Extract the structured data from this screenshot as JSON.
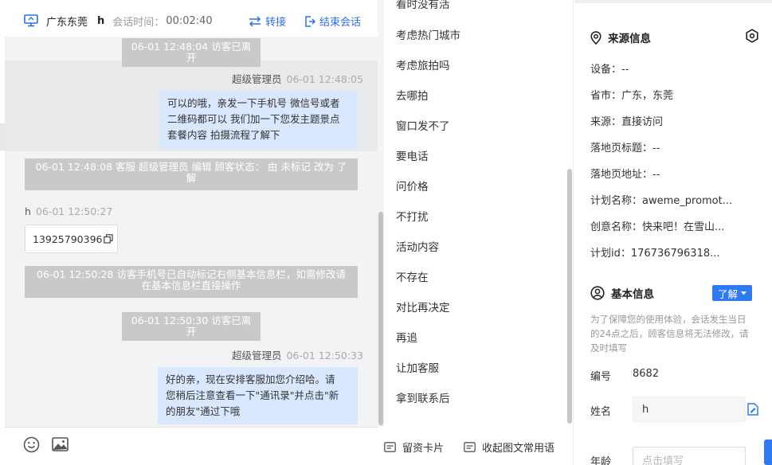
{
  "header": {
    "region": "广东东莞",
    "visitor_name": "h",
    "time_label": "会话时间：",
    "time_value": "00:02:40",
    "transfer_label": "转接",
    "end_label": "结束会话"
  },
  "messages": {
    "sys1": "06-01 12:48:04 访客已离开",
    "agent1_name": "超级管理员",
    "agent1_time": "06-01 12:48:05",
    "agent1_lines": [
      "可以的哦，亲发一下手机号 微信号或者",
      "二维码都可以 我们加一下您发主题景点",
      "套餐内容 拍摄流程了解下"
    ],
    "sys2_lines": [
      "06-01 12:48:08 客服 超级管理员 编辑 顾客状态： 由 未标记 改为 了",
      "解"
    ],
    "visitor_name": "h",
    "visitor_time": "06-01 12:50:27",
    "visitor_phone": "13925790396",
    "sys3_lines": [
      "06-01 12:50:28 访客手机号已自动标记右侧基本信息栏，如需修改请",
      "在基本信息栏直接操作"
    ],
    "sys4": "06-01 12:50:30 访客已离开",
    "agent2_name": "超级管理员",
    "agent2_time": "06-01 12:50:33",
    "agent2_lines": [
      "好的亲，现在安排客服加您介绍哈。请",
      "您稍后注意查看一下\"通讯录\"并点击\"新",
      "的朋友\"通过下哦"
    ]
  },
  "quick_replies": {
    "items": [
      "看时没有活",
      "考虑热门城市",
      "考虑旅拍吗",
      "去哪拍",
      "窗口发不了",
      "要电话",
      "问价格",
      "不打扰",
      "活动内容",
      "不存在",
      "对比再决定",
      "再追",
      "让加客服",
      "拿到联系后"
    ],
    "card_label": "留资卡片",
    "collect_label": "收起图文常用语"
  },
  "source_info": {
    "title": "来源信息",
    "device": "设备：--",
    "province": "省市：广东，东莞",
    "source": "来源：直接访问",
    "landing_title": "落地页标题：--",
    "landing_url": "落地页地址：--",
    "plan_name": "计划名称：aweme_promot...",
    "creative_name": "创意名称：快来吧！在雪山...",
    "plan_id": "计划id：176736796318..."
  },
  "basic_info": {
    "title": "基本信息",
    "know_label": "了解",
    "note_lines": [
      "为了保障您的使用体验，会话发生当日",
      "的24点之后，顾客信息将无法修改，请",
      "及时填写"
    ],
    "id_label": "编号",
    "id_value": "8682",
    "name_label": "姓名",
    "name_value": "h",
    "age_label": "年龄",
    "age_placeholder": "点击填写"
  }
}
